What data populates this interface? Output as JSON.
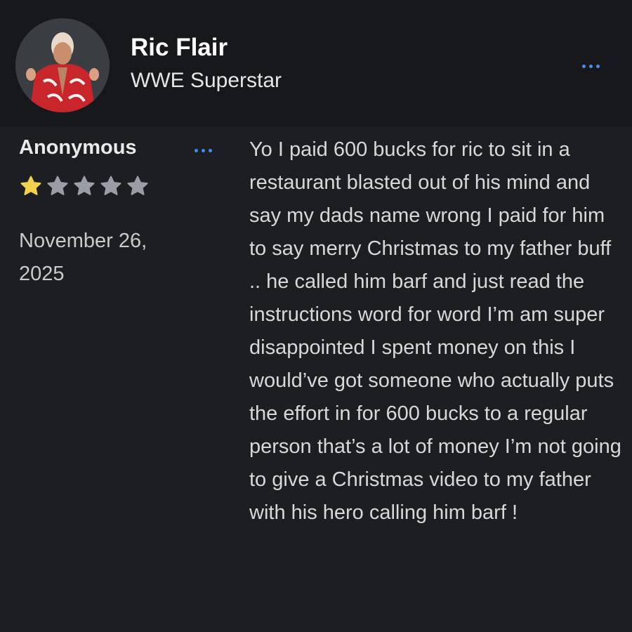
{
  "profile": {
    "name": "Ric Flair",
    "subtitle": "WWE Superstar",
    "avatar_icon": "profile-photo",
    "more_icon": "more-dots-icon"
  },
  "review": {
    "author": "Anonymous",
    "rating": 1,
    "rating_max": 5,
    "date": "November 26, 2025",
    "text": "Yo I paid 600 bucks for ric to sit in a restaurant blasted out of his mind and say my dads name wrong I paid for him to say merry Christmas to my father buff .. he called him barf and just read the instructions word for word I’m am super disappointed I spent money on this I would’ve got someone who actually puts the effort in for 600 bucks to a regular person that’s a lot of money I’m not going to give a Christmas video to my father with his hero calling him barf !"
  },
  "colors": {
    "accent": "#3d8ef5",
    "star_filled": "#f2d14c",
    "star_empty": "#9a9da3",
    "background": "#1c1e22",
    "header_background": "#17181b"
  }
}
